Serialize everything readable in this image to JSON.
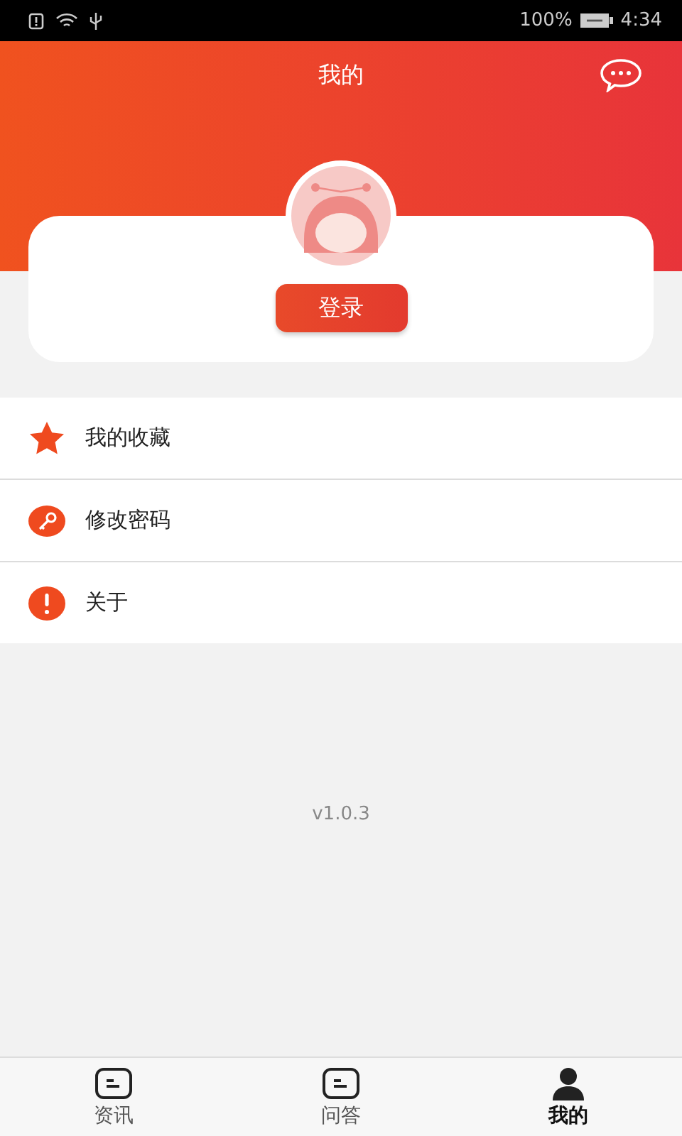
{
  "status_bar": {
    "battery": "100%",
    "time": "4:34"
  },
  "header": {
    "title": "我的"
  },
  "profile": {
    "login_button": "登录"
  },
  "menu": [
    {
      "kind": "star",
      "label": "我的收藏"
    },
    {
      "kind": "key",
      "label": "修改密码"
    },
    {
      "kind": "info",
      "label": "关于"
    }
  ],
  "version": "v1.0.3",
  "tab_bar": [
    {
      "kind": "news",
      "label": "资讯",
      "selected": false
    },
    {
      "kind": "qa",
      "label": "问答",
      "selected": false
    },
    {
      "kind": "me",
      "label": "我的",
      "selected": true
    }
  ]
}
